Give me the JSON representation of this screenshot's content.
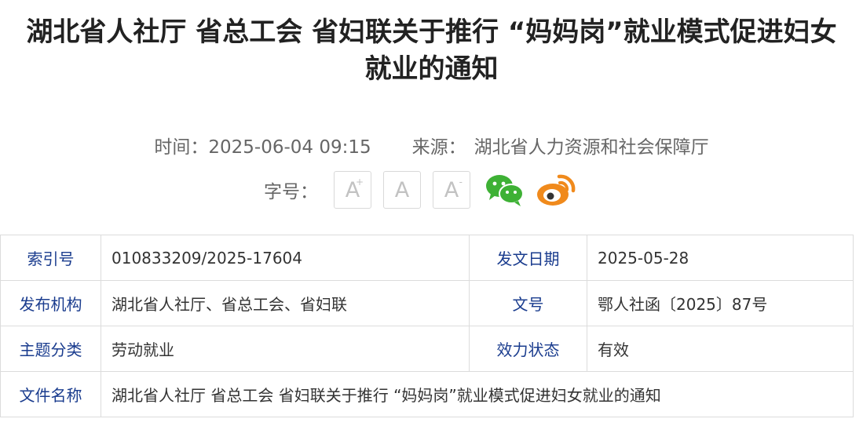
{
  "article": {
    "title": "湖北省人社厅 省总工会 省妇联关于推行 “妈妈岗”就业模式促进妇女就业的通知",
    "time_label": "时间：",
    "time_value": "2025-06-04 09:15",
    "source_label": "来源：",
    "source_value": "湖北省人力资源和社会保障厅"
  },
  "font_controls": {
    "label": "字号：",
    "increase": "A",
    "increase_mark": "+",
    "normal": "A",
    "decrease": "A",
    "decrease_mark": "-"
  },
  "share": {
    "wechat_icon": "wechat-icon",
    "weibo_icon": "weibo-icon",
    "wechat_color": "#3eb135",
    "weibo_color": "#f08a1c"
  },
  "info_table": [
    {
      "k1": "索引号",
      "v1": "010833209/2025-17604",
      "k2": "发文日期",
      "v2": "2025-05-28"
    },
    {
      "k1": "发布机构",
      "v1": "湖北省人社厅、省总工会、省妇联",
      "k2": "文号",
      "v2": "鄂人社函〔2025〕87号"
    },
    {
      "k1": "主题分类",
      "v1": "劳动就业",
      "k2": "效力状态",
      "v2": "有效"
    },
    {
      "k1": "文件名称",
      "v1": "湖北省人社厅 省总工会 省妇联关于推行 “妈妈岗”就业模式促进妇女就业的通知"
    }
  ]
}
